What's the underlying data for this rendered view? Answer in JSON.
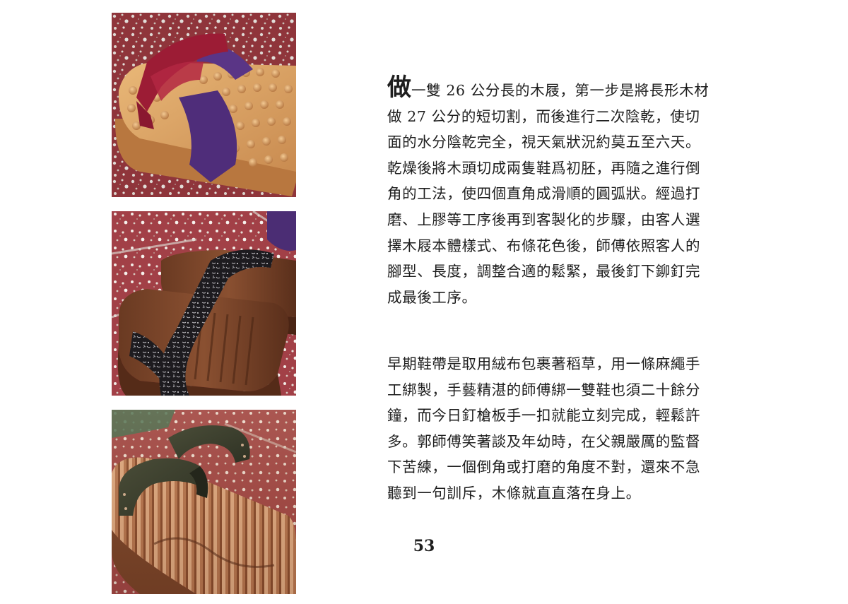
{
  "page": {
    "number": "53"
  },
  "photos": [
    {
      "icon": "red-purple-geta-photo-icon"
    },
    {
      "icon": "dark-floral-geta-photo-icon"
    },
    {
      "icon": "green-strap-geta-photo-icon"
    }
  ],
  "paragraphs": [
    {
      "lead": "做",
      "lines": [
        "一雙 26 公分長的木屐，第一步是將長形木材",
        "做 27 公分的短切割，而後進行二次陰乾，使切",
        "面的水分陰乾完全，視天氣狀況約莫五至六天。",
        "乾燥後將木頭切成兩隻鞋爲初胚，再隨之進行倒",
        "角的工法，使四個直角成滑順的圓弧狀。經過打",
        "磨、上膠等工序後再到客製化的步驟，由客人選",
        "擇木屐本體樣式、布條花色後，師傅依照客人的",
        "腳型、長度，調整合適的鬆緊，最後釘下鉚釘完",
        "成最後工序。"
      ]
    },
    {
      "lines": [
        "早期鞋帶是取用絨布包裹著稻草，用一條麻繩手",
        "工綁製，手藝精湛的師傅綁一雙鞋也須二十餘分",
        "鐘，而今日釘槍板手一扣就能立刻完成，輕鬆許",
        "多。郭師傅笑著談及年幼時，在父親嚴厲的監督",
        "下苦練，一個倒角或打磨的角度不對，還來不急",
        "聽到一句訓斥，木條就直直落在身上。"
      ]
    }
  ]
}
